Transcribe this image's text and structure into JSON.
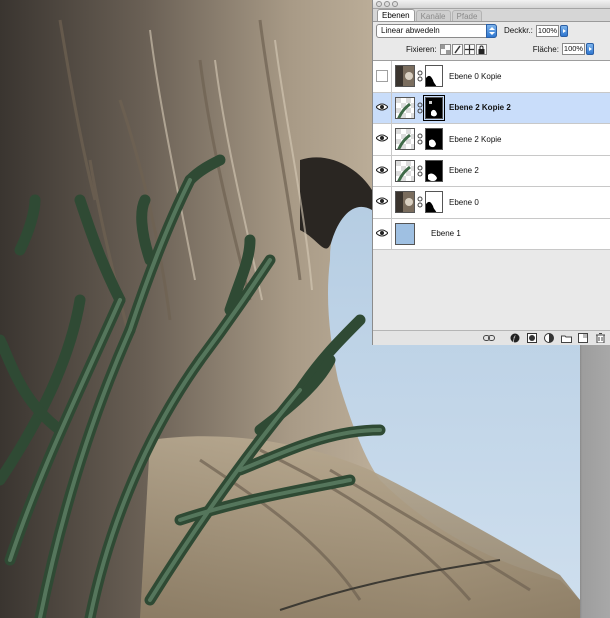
{
  "palette": {
    "tabs": [
      {
        "label": "Ebenen",
        "active": true
      },
      {
        "label": "Kanäle",
        "active": false
      },
      {
        "label": "Pfade",
        "active": false
      }
    ],
    "blend_mode": "Linear abwedeln",
    "opacity_label": "Deckkr.:",
    "opacity_value": "100%",
    "lock_label": "Fixieren:",
    "fill_label": "Fläche:",
    "fill_value": "100%",
    "layers": [
      {
        "name": "Ebene 0 Kopie",
        "visible": false,
        "selected": false,
        "has_mask": true
      },
      {
        "name": "Ebene 2 Kopie 2",
        "visible": true,
        "selected": true,
        "has_mask": true
      },
      {
        "name": "Ebene 2 Kopie",
        "visible": true,
        "selected": false,
        "has_mask": true
      },
      {
        "name": "Ebene 2",
        "visible": true,
        "selected": false,
        "has_mask": true
      },
      {
        "name": "Ebene 0",
        "visible": true,
        "selected": false,
        "has_mask": true
      },
      {
        "name": "Ebene 1",
        "visible": true,
        "selected": false,
        "has_mask": false
      }
    ],
    "bottom_icons": [
      "link-icon",
      "layer-style-icon",
      "mask-icon",
      "adjustment-icon",
      "group-icon",
      "new-layer-icon",
      "trash-icon"
    ]
  },
  "colors": {
    "sky": "#c9dcec",
    "selection": "#c9ddfa",
    "accent": "#2f77d0"
  }
}
